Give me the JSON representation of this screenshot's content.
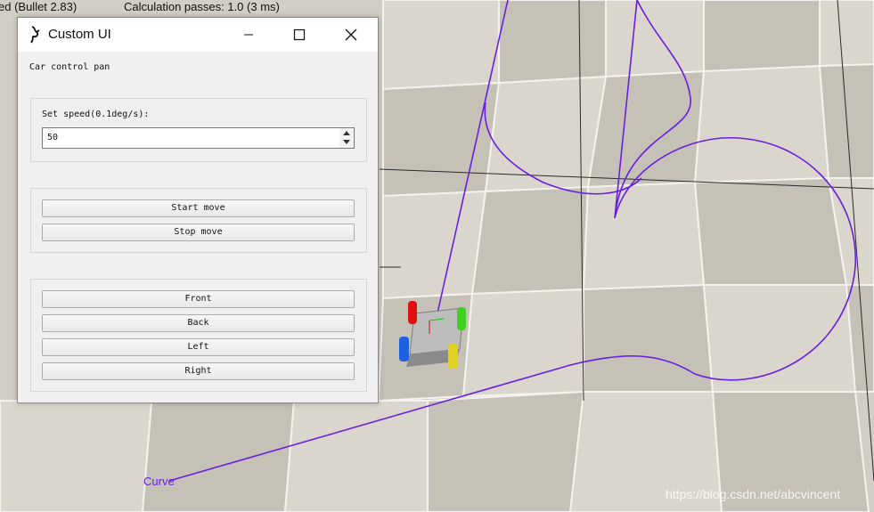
{
  "status": {
    "engine_text": "ed (Bullet 2.83)",
    "passes_text": "Calculation passes: 1.0 (3 ms)"
  },
  "scene": {
    "curve_label": "Curve",
    "watermark": "https://blog.csdn.net/abcvincent",
    "curve_color": "#6a1fe0",
    "floor_light": "#d9d5cc",
    "floor_dark": "#c4c0b6"
  },
  "dialog": {
    "title": "Custom UI",
    "title_icon": "lizard-icon",
    "panel_label": "Car control pan",
    "speed": {
      "label": "Set speed(0.1deg/s):",
      "value": "50"
    },
    "move_buttons": {
      "start": "Start move",
      "stop": "Stop move"
    },
    "direction_buttons": {
      "front": "Front",
      "back": "Back",
      "left": "Left",
      "right": "Right"
    }
  }
}
